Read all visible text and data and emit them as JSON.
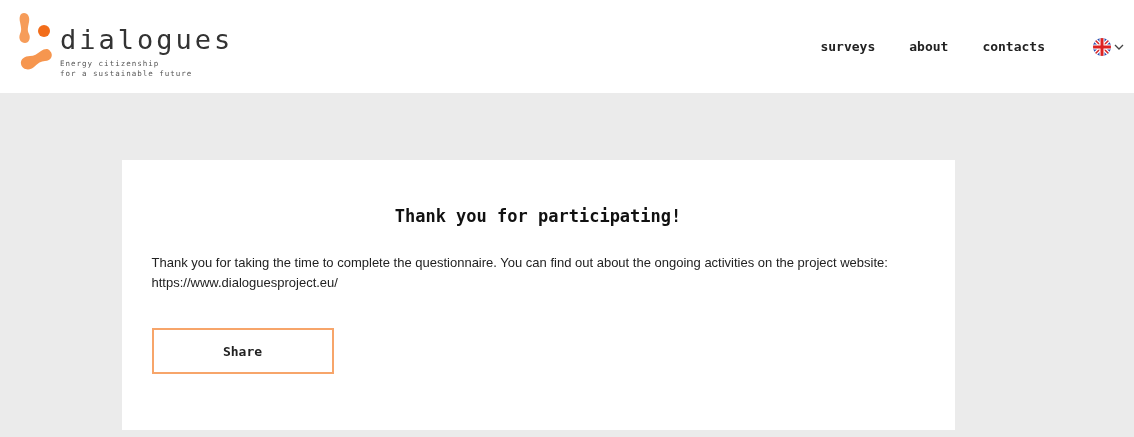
{
  "header": {
    "logo": {
      "name": "dialogues",
      "tagline_lines": [
        "Energy citizenship",
        "for a sustainable future"
      ]
    },
    "nav": [
      {
        "label": "surveys"
      },
      {
        "label": "about"
      },
      {
        "label": "contacts"
      }
    ]
  },
  "card": {
    "title": "Thank you for participating!",
    "message": "Thank you for taking the time to complete the questionnaire. You can find out about the ongoing activities on the project website: https://www.dialoguesproject.eu/",
    "button": "Share"
  }
}
